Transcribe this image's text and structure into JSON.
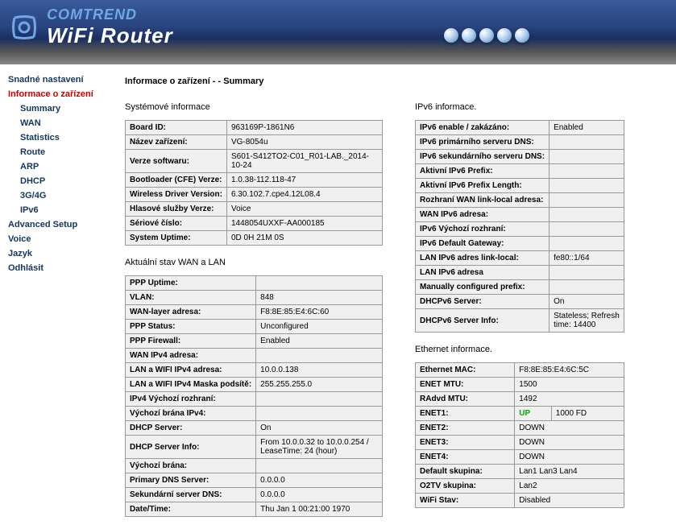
{
  "brand": "COMTREND",
  "product": "WiFi Router",
  "page_title": "Informace o zařízení - - Summary",
  "nav": {
    "quick": "Snadné nastavení",
    "device_info": "Informace o zařízení",
    "summary": "Summary",
    "wan": "WAN",
    "statistics": "Statistics",
    "route": "Route",
    "arp": "ARP",
    "dhcp": "DHCP",
    "g34g": "3G/4G",
    "ipv6": "IPv6",
    "advanced": "Advanced Setup",
    "voice": "Voice",
    "jazyk": "Jazyk",
    "logout": "Odhlásit"
  },
  "sys_title": "Systémové informace",
  "sys": [
    {
      "k": "Board ID:",
      "v": "963169P-1861N6"
    },
    {
      "k": "Název zařízení:",
      "v": "VG-8054u"
    },
    {
      "k": "Verze softwaru:",
      "v": "S601-S412TO2-C01_R01-LAB._2014-10-24"
    },
    {
      "k": "Bootloader (CFE) Verze:",
      "v": "1.0.38-112.118-47"
    },
    {
      "k": "Wireless Driver Version:",
      "v": "6.30.102.7.cpe4.12L08.4"
    },
    {
      "k": "Hlasové služby Verze:",
      "v": "Voice"
    },
    {
      "k": "Sériové číslo:",
      "v": "1448054UXXF-AA000185"
    },
    {
      "k": "System Uptime:",
      "v": "0D 0H 21M 0S"
    }
  ],
  "wanlan_title": "Aktuální stav WAN a LAN",
  "wanlan": [
    {
      "k": "PPP Uptime:",
      "v": ""
    },
    {
      "k": "VLAN:",
      "v": "848"
    },
    {
      "k": "WAN-layer adresa:",
      "v": "F8:8E:85:E4:6C:60"
    },
    {
      "k": "PPP Status:",
      "v": "Unconfigured"
    },
    {
      "k": "PPP Firewall:",
      "v": "Enabled"
    },
    {
      "k": "WAN IPv4 adresa:",
      "v": ""
    },
    {
      "k": "LAN a WIFI IPv4 adresa:",
      "v": "10.0.0.138"
    },
    {
      "k": "LAN a WIFI IPv4 Maska podsítě:",
      "v": "255.255.255.0"
    },
    {
      "k": "IPv4 Výchozí rozhraní:",
      "v": ""
    },
    {
      "k": "Výchozí brána IPv4:",
      "v": ""
    },
    {
      "k": "DHCP Server:",
      "v": "On"
    },
    {
      "k": "DHCP Server Info:",
      "v": "From 10.0.0.32 to 10.0.0.254 / LeaseTime: 24 (hour)"
    },
    {
      "k": "Výchozí brána:",
      "v": ""
    },
    {
      "k": "Primary DNS Server:",
      "v": "0.0.0.0"
    },
    {
      "k": "Sekundární server DNS:",
      "v": "0.0.0.0"
    },
    {
      "k": "Date/Time:",
      "v": "Thu Jan 1 00:21:00 1970"
    }
  ],
  "ipv6_title": "IPv6 informace.",
  "ipv6": [
    {
      "k": "IPv6 enable / zakázáno:",
      "v": "Enabled"
    },
    {
      "k": "IPv6 primárního serveru DNS:",
      "v": ""
    },
    {
      "k": "IPv6 sekundárního serveru DNS:",
      "v": ""
    },
    {
      "k": "Aktivní IPv6 Prefix:",
      "v": ""
    },
    {
      "k": "Aktivní IPv6 Prefix Length:",
      "v": ""
    },
    {
      "k": "Rozhraní WAN link-local adresa:",
      "v": ""
    },
    {
      "k": "WAN IPv6 adresa:",
      "v": ""
    },
    {
      "k": "IPv6 Výchozí rozhraní:",
      "v": ""
    },
    {
      "k": "IPv6 Default Gateway:",
      "v": ""
    },
    {
      "k": "LAN IPv6 adres link-local:",
      "v": "fe80::1/64"
    },
    {
      "k": "LAN IPv6 adresa",
      "v": ""
    },
    {
      "k": "Manually configured prefix:",
      "v": ""
    },
    {
      "k": "DHCPv6 Server:",
      "v": "On"
    },
    {
      "k": "DHCPv6 Server Info:",
      "v": "Stateless; Refresh time: 14400"
    }
  ],
  "eth_title": "Ethernet informace.",
  "eth": [
    {
      "k": "Ethernet MAC:",
      "v": "F8:8E:85:E4:6C:5C"
    },
    {
      "k": "ENET MTU:",
      "v": "1500"
    },
    {
      "k": "RAdvd MTU:",
      "v": "1492"
    }
  ],
  "enet1": {
    "k": "ENET1:",
    "status": "UP",
    "speed": "1000 FD"
  },
  "enet_other": [
    {
      "k": "ENET2:",
      "v": "DOWN"
    },
    {
      "k": "ENET3:",
      "v": "DOWN"
    },
    {
      "k": "ENET4:",
      "v": "DOWN"
    }
  ],
  "eth_rest": [
    {
      "k": "Default skupina:",
      "v": "Lan1 Lan3 Lan4"
    },
    {
      "k": "O2TV skupina:",
      "v": "Lan2"
    },
    {
      "k": "WiFi Stav:",
      "v": "Disabled"
    }
  ]
}
